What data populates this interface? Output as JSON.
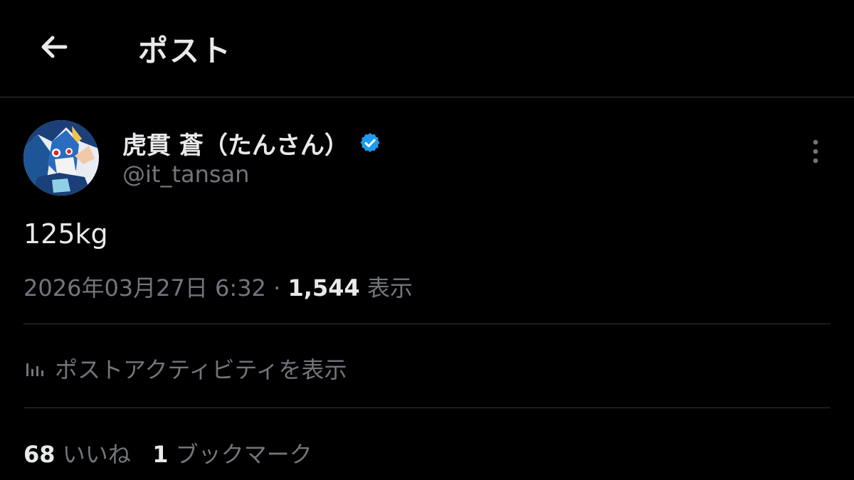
{
  "header": {
    "title": "ポスト",
    "back_icon": "arrow-left-icon"
  },
  "author": {
    "display_name": "虎貫 蒼（たんさん）",
    "handle": "@it_tansan",
    "verified": true,
    "verified_color": "#1d9bf0"
  },
  "post": {
    "text": "125kg",
    "date": "2026年03月27日 6:32",
    "separator": "·",
    "views_count": "1,544",
    "views_label": "表示"
  },
  "activity": {
    "label": "ポストアクティビティを表示",
    "icon": "bar-chart-icon"
  },
  "stats": {
    "likes_count": "68",
    "likes_label": "いいね",
    "bookmarks_count": "1",
    "bookmarks_label": "ブックマーク"
  },
  "colors": {
    "background": "#000000",
    "primary_text": "#e7e9ea",
    "secondary_text": "#71767b",
    "divider": "#2f3336"
  }
}
